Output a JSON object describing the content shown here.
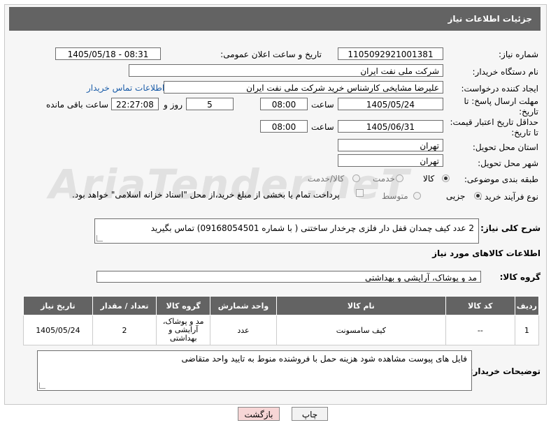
{
  "header": {
    "title": "جزئیات اطلاعات نیاز"
  },
  "watermark": "AriaTender.neT",
  "form": {
    "need_number": {
      "label": "شماره نیاز:",
      "value": "1105092921001381"
    },
    "announce": {
      "label": "تاریخ و ساعت اعلان عمومی:",
      "value": "1405/05/18 - 08:31"
    },
    "buyer_org": {
      "label": "نام دستگاه خریدار:",
      "value": "شرکت ملی نفت ایران"
    },
    "requester": {
      "label": "ایجاد کننده درخواست:",
      "value": "علیرضا مشایخی کارشناس خرید  شرکت ملی نفت ایران",
      "contact_link": "اطلاعات تماس خریدار"
    },
    "reply_deadline": {
      "label_line1": "مهلت ارسال پاسخ: تا",
      "label_line2": "تاریخ:",
      "date": "1405/05/24",
      "time_label": "ساعت",
      "time": "08:00",
      "days": "5",
      "days_label": "روز و",
      "remaining": "22:27:08",
      "remaining_label": "ساعت باقی مانده"
    },
    "price_validity": {
      "label_line1": "حداقل تاریخ اعتبار قیمت:",
      "label_line2": "تا تاریخ:",
      "date": "1405/06/31",
      "time_label": "ساعت",
      "time": "08:00"
    },
    "province": {
      "label": "استان محل تحویل:",
      "value": "تهران"
    },
    "city": {
      "label": "شهر محل تحویل:",
      "value": "تهران"
    },
    "category": {
      "label": "طبقه بندی موضوعی:",
      "options": [
        "کالا",
        "خدمت",
        "کالا/خدمت"
      ],
      "selected": "کالا"
    },
    "purchase_type": {
      "label": "نوع فرآیند خرید :",
      "options": [
        "جزیی",
        "متوسط"
      ],
      "selected": "جزیی",
      "payment_note": "پرداخت تمام یا بخشی از مبلغ خرید،از محل \"اسناد خزانه اسلامی\" خواهد بود."
    }
  },
  "description": {
    "label": "شرح کلی نیاز:",
    "value": "2 عدد کیف چمدان قفل دار فلزی چرخدار ساختنی ( با شماره 09168054501) تماس بگیرید"
  },
  "goods": {
    "section_title": "اطلاعات کالاهای مورد نیاز",
    "group_label": "گروه کالا:",
    "group_value": "مد و پوشاک، آرایشی و بهداشتی",
    "columns": [
      "ردیف",
      "کد کالا",
      "نام کالا",
      "واحد شمارش",
      "گروه کالا",
      "تعداد / مقدار",
      "تاریخ نیاز"
    ],
    "rows": [
      {
        "row": "1",
        "code": "--",
        "name": "کیف سامسونت",
        "unit": "عدد",
        "group_l1": "مد و پوشاک،",
        "group_l2": "آرایشی و",
        "group_l3": "بهداشتی",
        "qty": "2",
        "date": "1405/05/24"
      }
    ]
  },
  "buyer_notes": {
    "label": "توضیحات خریدار:",
    "value": "فایل های پیوست مشاهده شود هزینه حمل با فروشنده منوط به تایید واحد متقاضی"
  },
  "buttons": {
    "print": "چاپ",
    "back": "بازگشت"
  },
  "colors": {
    "header_bg": "#636363",
    "link": "#1a5ca8",
    "back_button_bg": "#f7d6d6"
  }
}
